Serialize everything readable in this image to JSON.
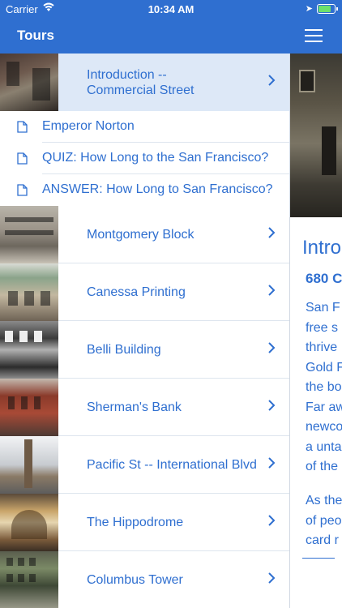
{
  "status_bar": {
    "carrier": "Carrier",
    "time": "10:34 AM"
  },
  "nav": {
    "title": "Tours",
    "menu_icon": "hamburger-menu-icon"
  },
  "list": {
    "selected": {
      "line1": "Introduction --",
      "line2": "Commercial Street"
    },
    "subitems": [
      {
        "label": "Emperor Norton",
        "icon": "document-icon"
      },
      {
        "label": "QUIZ: How Long to the San Francisco?",
        "icon": "document-icon"
      },
      {
        "label": "ANSWER: How Long to San Francisco?",
        "icon": "document-icon"
      }
    ],
    "items": [
      {
        "label": "Montgomery Block"
      },
      {
        "label": "Canessa Printing"
      },
      {
        "label": "Belli Building"
      },
      {
        "label": "Sherman's Bank"
      },
      {
        "label": "Pacific St -- International Blvd"
      },
      {
        "label": "The Hippodrome"
      },
      {
        "label": "Columbus Tower"
      }
    ]
  },
  "detail": {
    "heading": "Intro",
    "subheading": "680 C",
    "para1": [
      "San F",
      "free s",
      "thrive",
      "Gold F",
      "the bo",
      "Far aw",
      "newco",
      "a unta",
      "of the"
    ],
    "para2": [
      "As the",
      "of peo",
      "card r"
    ]
  },
  "colors": {
    "accent": "#2f6fd0",
    "selected_row": "#dde8f7",
    "separator": "#dde5ee"
  }
}
